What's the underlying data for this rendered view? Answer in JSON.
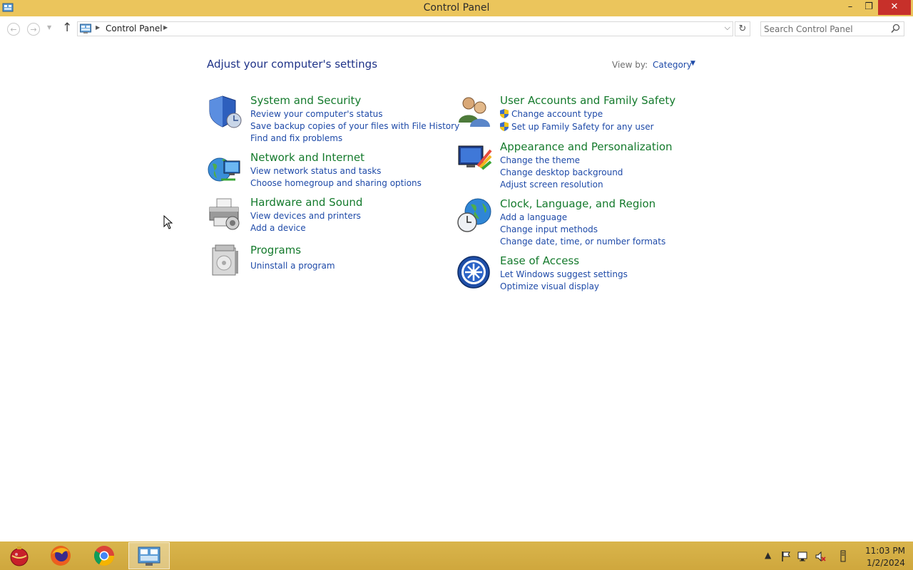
{
  "window": {
    "title": "Control Panel",
    "minimize_glyph": "–",
    "restore_glyph": "❐",
    "close_glyph": "✕"
  },
  "address_bar": {
    "back_glyph": "←",
    "forward_glyph": "→",
    "recent_glyph": "▼",
    "up_glyph": "↑",
    "separator": "▶",
    "breadcrumb": "Control Panel",
    "dropdown_glyph": "⌵",
    "refresh_glyph": "↻"
  },
  "search": {
    "placeholder": "Search Control Panel"
  },
  "main": {
    "heading": "Adjust your computer's settings",
    "view_by_label": "View by:",
    "view_by_value": "Category",
    "view_by_caret": "▼"
  },
  "categories": {
    "system_security": {
      "title": "System and Security",
      "links": [
        "Review your computer's status",
        "Save backup copies of your files with File History",
        "Find and fix problems"
      ]
    },
    "network_internet": {
      "title": "Network and Internet",
      "links": [
        "View network status and tasks",
        "Choose homegroup and sharing options"
      ]
    },
    "hardware_sound": {
      "title": "Hardware and Sound",
      "links": [
        "View devices and printers",
        "Add a device"
      ]
    },
    "programs": {
      "title": "Programs",
      "links": [
        "Uninstall a program"
      ]
    },
    "user_accounts": {
      "title": "User Accounts and Family Safety",
      "links": [
        "Change account type",
        "Set up Family Safety for any user"
      ]
    },
    "appearance": {
      "title": "Appearance and Personalization",
      "links": [
        "Change the theme",
        "Change desktop background",
        "Adjust screen resolution"
      ]
    },
    "clock_region": {
      "title": "Clock, Language, and Region",
      "links": [
        "Add a language",
        "Change input methods",
        "Change date, time, or number formats"
      ]
    },
    "ease_of_access": {
      "title": "Ease of Access",
      "links": [
        "Let Windows suggest settings",
        "Optimize visual display"
      ]
    }
  },
  "taskbar": {
    "apps": [
      "ornament-app-icon",
      "firefox-icon",
      "chrome-icon",
      "control-panel-icon"
    ],
    "tray_up_glyph": "▲",
    "time": "11:03 PM",
    "date": "1/2/2024"
  },
  "colors": {
    "titlebar": "#ebc55c",
    "taskbar": "#d4ad44",
    "close_button": "#c7302a",
    "category_title": "#147a2c",
    "link": "#1e4aa8",
    "heading": "#1e3287"
  }
}
